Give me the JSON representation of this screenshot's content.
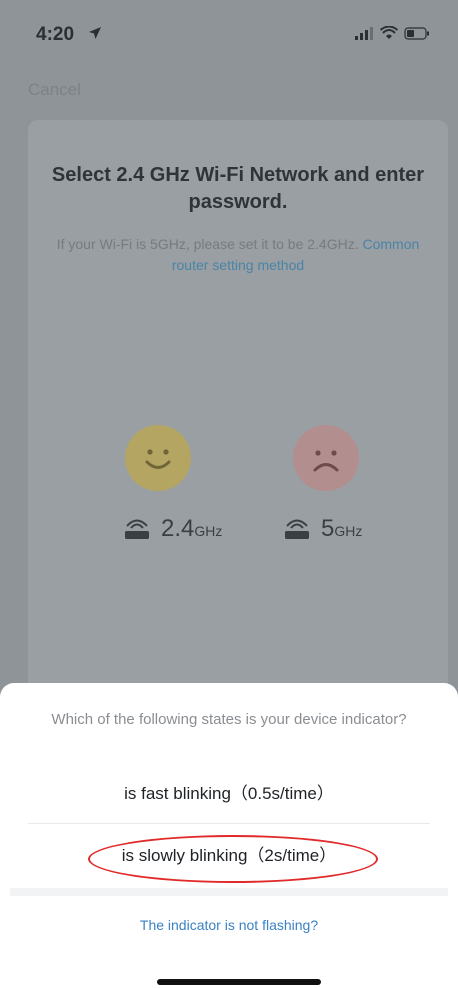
{
  "status_bar": {
    "time": "4:20",
    "location_icon": "location-arrow-icon",
    "signal_icon": "cellular-signal-icon",
    "wifi_icon": "wifi-icon",
    "battery_icon": "battery-icon"
  },
  "nav": {
    "cancel_label": "Cancel"
  },
  "card": {
    "title": "Select 2.4 GHz Wi-Fi Network and enter password.",
    "subtitle": "If your Wi-Fi is 5GHz, please set it to be 2.4GHz.",
    "link": "Common router setting method",
    "band_good_main": "2.4",
    "band_good_unit": "GHz",
    "band_bad_main": "5",
    "band_bad_unit": "GHz"
  },
  "sheet": {
    "question": "Which of the following states is your device indicator?",
    "option_fast": "is fast blinking（0.5s/time）",
    "option_slow": "is slowly blinking（2s/time）",
    "not_flashing": "The indicator is not flashing?"
  },
  "colors": {
    "accent_link": "#3b82c4",
    "highlight": "#e12a2a"
  }
}
